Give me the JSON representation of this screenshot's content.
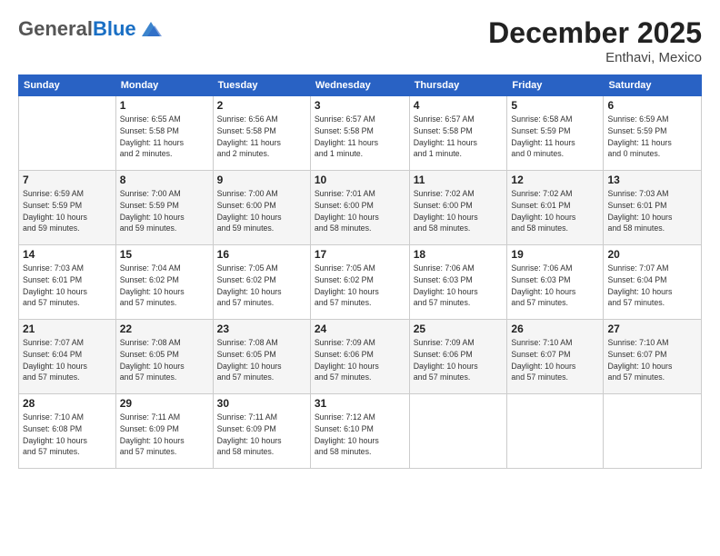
{
  "header": {
    "logo_general": "General",
    "logo_blue": "Blue",
    "month_title": "December 2025",
    "location": "Enthavi, Mexico"
  },
  "weekdays": [
    "Sunday",
    "Monday",
    "Tuesday",
    "Wednesday",
    "Thursday",
    "Friday",
    "Saturday"
  ],
  "weeks": [
    [
      {
        "day": "",
        "info": ""
      },
      {
        "day": "1",
        "info": "Sunrise: 6:55 AM\nSunset: 5:58 PM\nDaylight: 11 hours\nand 2 minutes."
      },
      {
        "day": "2",
        "info": "Sunrise: 6:56 AM\nSunset: 5:58 PM\nDaylight: 11 hours\nand 2 minutes."
      },
      {
        "day": "3",
        "info": "Sunrise: 6:57 AM\nSunset: 5:58 PM\nDaylight: 11 hours\nand 1 minute."
      },
      {
        "day": "4",
        "info": "Sunrise: 6:57 AM\nSunset: 5:58 PM\nDaylight: 11 hours\nand 1 minute."
      },
      {
        "day": "5",
        "info": "Sunrise: 6:58 AM\nSunset: 5:59 PM\nDaylight: 11 hours\nand 0 minutes."
      },
      {
        "day": "6",
        "info": "Sunrise: 6:59 AM\nSunset: 5:59 PM\nDaylight: 11 hours\nand 0 minutes."
      }
    ],
    [
      {
        "day": "7",
        "info": "Sunrise: 6:59 AM\nSunset: 5:59 PM\nDaylight: 10 hours\nand 59 minutes."
      },
      {
        "day": "8",
        "info": "Sunrise: 7:00 AM\nSunset: 5:59 PM\nDaylight: 10 hours\nand 59 minutes."
      },
      {
        "day": "9",
        "info": "Sunrise: 7:00 AM\nSunset: 6:00 PM\nDaylight: 10 hours\nand 59 minutes."
      },
      {
        "day": "10",
        "info": "Sunrise: 7:01 AM\nSunset: 6:00 PM\nDaylight: 10 hours\nand 58 minutes."
      },
      {
        "day": "11",
        "info": "Sunrise: 7:02 AM\nSunset: 6:00 PM\nDaylight: 10 hours\nand 58 minutes."
      },
      {
        "day": "12",
        "info": "Sunrise: 7:02 AM\nSunset: 6:01 PM\nDaylight: 10 hours\nand 58 minutes."
      },
      {
        "day": "13",
        "info": "Sunrise: 7:03 AM\nSunset: 6:01 PM\nDaylight: 10 hours\nand 58 minutes."
      }
    ],
    [
      {
        "day": "14",
        "info": "Sunrise: 7:03 AM\nSunset: 6:01 PM\nDaylight: 10 hours\nand 57 minutes."
      },
      {
        "day": "15",
        "info": "Sunrise: 7:04 AM\nSunset: 6:02 PM\nDaylight: 10 hours\nand 57 minutes."
      },
      {
        "day": "16",
        "info": "Sunrise: 7:05 AM\nSunset: 6:02 PM\nDaylight: 10 hours\nand 57 minutes."
      },
      {
        "day": "17",
        "info": "Sunrise: 7:05 AM\nSunset: 6:02 PM\nDaylight: 10 hours\nand 57 minutes."
      },
      {
        "day": "18",
        "info": "Sunrise: 7:06 AM\nSunset: 6:03 PM\nDaylight: 10 hours\nand 57 minutes."
      },
      {
        "day": "19",
        "info": "Sunrise: 7:06 AM\nSunset: 6:03 PM\nDaylight: 10 hours\nand 57 minutes."
      },
      {
        "day": "20",
        "info": "Sunrise: 7:07 AM\nSunset: 6:04 PM\nDaylight: 10 hours\nand 57 minutes."
      }
    ],
    [
      {
        "day": "21",
        "info": "Sunrise: 7:07 AM\nSunset: 6:04 PM\nDaylight: 10 hours\nand 57 minutes."
      },
      {
        "day": "22",
        "info": "Sunrise: 7:08 AM\nSunset: 6:05 PM\nDaylight: 10 hours\nand 57 minutes."
      },
      {
        "day": "23",
        "info": "Sunrise: 7:08 AM\nSunset: 6:05 PM\nDaylight: 10 hours\nand 57 minutes."
      },
      {
        "day": "24",
        "info": "Sunrise: 7:09 AM\nSunset: 6:06 PM\nDaylight: 10 hours\nand 57 minutes."
      },
      {
        "day": "25",
        "info": "Sunrise: 7:09 AM\nSunset: 6:06 PM\nDaylight: 10 hours\nand 57 minutes."
      },
      {
        "day": "26",
        "info": "Sunrise: 7:10 AM\nSunset: 6:07 PM\nDaylight: 10 hours\nand 57 minutes."
      },
      {
        "day": "27",
        "info": "Sunrise: 7:10 AM\nSunset: 6:07 PM\nDaylight: 10 hours\nand 57 minutes."
      }
    ],
    [
      {
        "day": "28",
        "info": "Sunrise: 7:10 AM\nSunset: 6:08 PM\nDaylight: 10 hours\nand 57 minutes."
      },
      {
        "day": "29",
        "info": "Sunrise: 7:11 AM\nSunset: 6:09 PM\nDaylight: 10 hours\nand 57 minutes."
      },
      {
        "day": "30",
        "info": "Sunrise: 7:11 AM\nSunset: 6:09 PM\nDaylight: 10 hours\nand 58 minutes."
      },
      {
        "day": "31",
        "info": "Sunrise: 7:12 AM\nSunset: 6:10 PM\nDaylight: 10 hours\nand 58 minutes."
      },
      {
        "day": "",
        "info": ""
      },
      {
        "day": "",
        "info": ""
      },
      {
        "day": "",
        "info": ""
      }
    ]
  ]
}
